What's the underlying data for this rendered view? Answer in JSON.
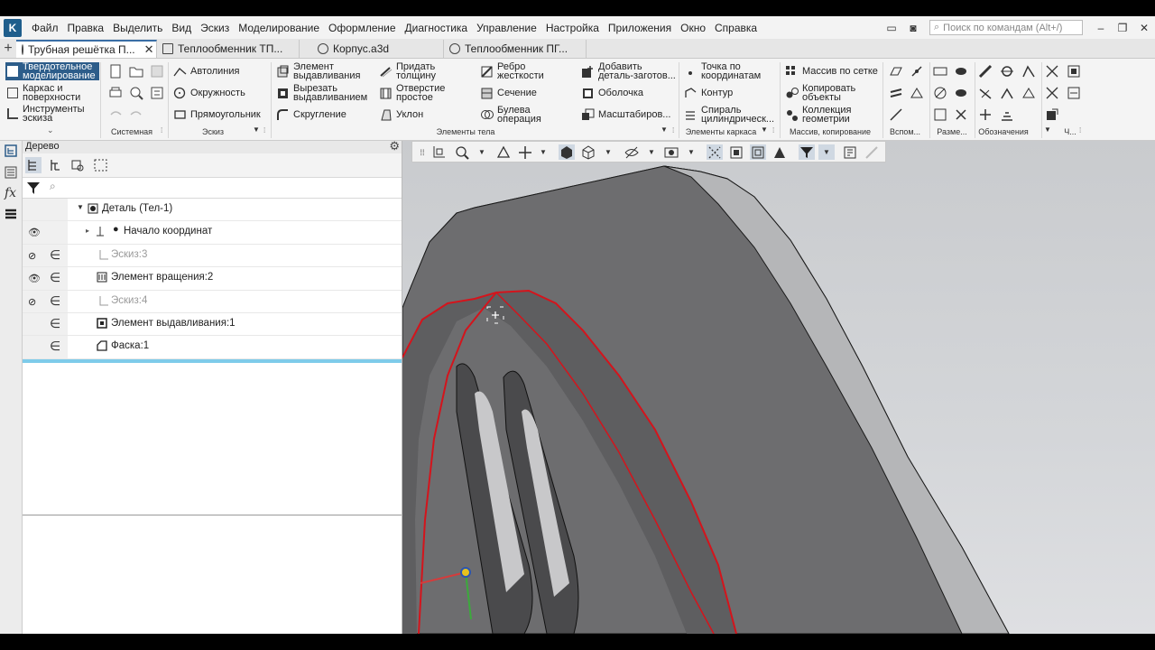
{
  "menu": {
    "items": [
      "Файл",
      "Правка",
      "Выделить",
      "Вид",
      "Эскиз",
      "Моделирование",
      "Оформление",
      "Диагностика",
      "Управление",
      "Настройка",
      "Приложения",
      "Окно",
      "Справка"
    ],
    "search_placeholder": "Поиск по командам (Alt+/)"
  },
  "tabs": [
    {
      "label": "Трубная решётка П...",
      "active": true
    },
    {
      "label": "Теплообменник ТП...",
      "active": false
    },
    {
      "label": "Корпус.a3d",
      "active": false
    },
    {
      "label": "Теплообменник ПГ...",
      "active": false
    }
  ],
  "ribbon": {
    "modes": [
      "Твердотельное моделирование",
      "Каркас и поверхности",
      "Инструменты эскиза"
    ],
    "groups": {
      "system": "Системная",
      "sketch": "Эскиз",
      "body": "Элементы тела",
      "frame": "Элементы каркаса",
      "array": "Массив, копирование",
      "aux": "Вспом...",
      "dims": "Разме...",
      "marks": "Обозначения",
      "more": "Ч..."
    },
    "sketch_tools": [
      "Автолиния",
      "Окружность",
      "Прямоугольник"
    ],
    "body_tools": [
      "Элемент выдавливания",
      "Вырезать выдавливанием",
      "Скругление",
      "Придать толщину",
      "Отверстие простое",
      "Уклон",
      "Ребро жесткости",
      "Сечение",
      "Булева операция",
      "Добавить деталь-заготов...",
      "Оболочка",
      "Масштабиров..."
    ],
    "frame_tools": [
      "Точка по координатам",
      "Контур",
      "Спираль цилиндрическ..."
    ],
    "array_tools": [
      "Массив по сетке",
      "Копировать объекты",
      "Коллекция геометрии"
    ]
  },
  "tree": {
    "title": "Дерево",
    "rows": [
      {
        "label": "Деталь (Тел-1)",
        "dim": false,
        "eye": "",
        "inclusion": false
      },
      {
        "label": "Начало координат",
        "dim": false,
        "eye": "visible",
        "inclusion": false
      },
      {
        "label": "Эскиз:3",
        "dim": true,
        "eye": "hidden",
        "inclusion": true
      },
      {
        "label": "Элемент вращения:2",
        "dim": false,
        "eye": "visible",
        "inclusion": true
      },
      {
        "label": "Эскиз:4",
        "dim": true,
        "eye": "hidden",
        "inclusion": true
      },
      {
        "label": "Элемент выдавливания:1",
        "dim": false,
        "eye": "",
        "inclusion": true
      },
      {
        "label": "Фаска:1",
        "dim": false,
        "eye": "",
        "inclusion": true
      }
    ]
  },
  "colors": {
    "accent": "#2d5d8a",
    "selection_edge": "#d4141c",
    "model_face": "#6f6f6f",
    "selection_bar": "#7ecbea"
  }
}
